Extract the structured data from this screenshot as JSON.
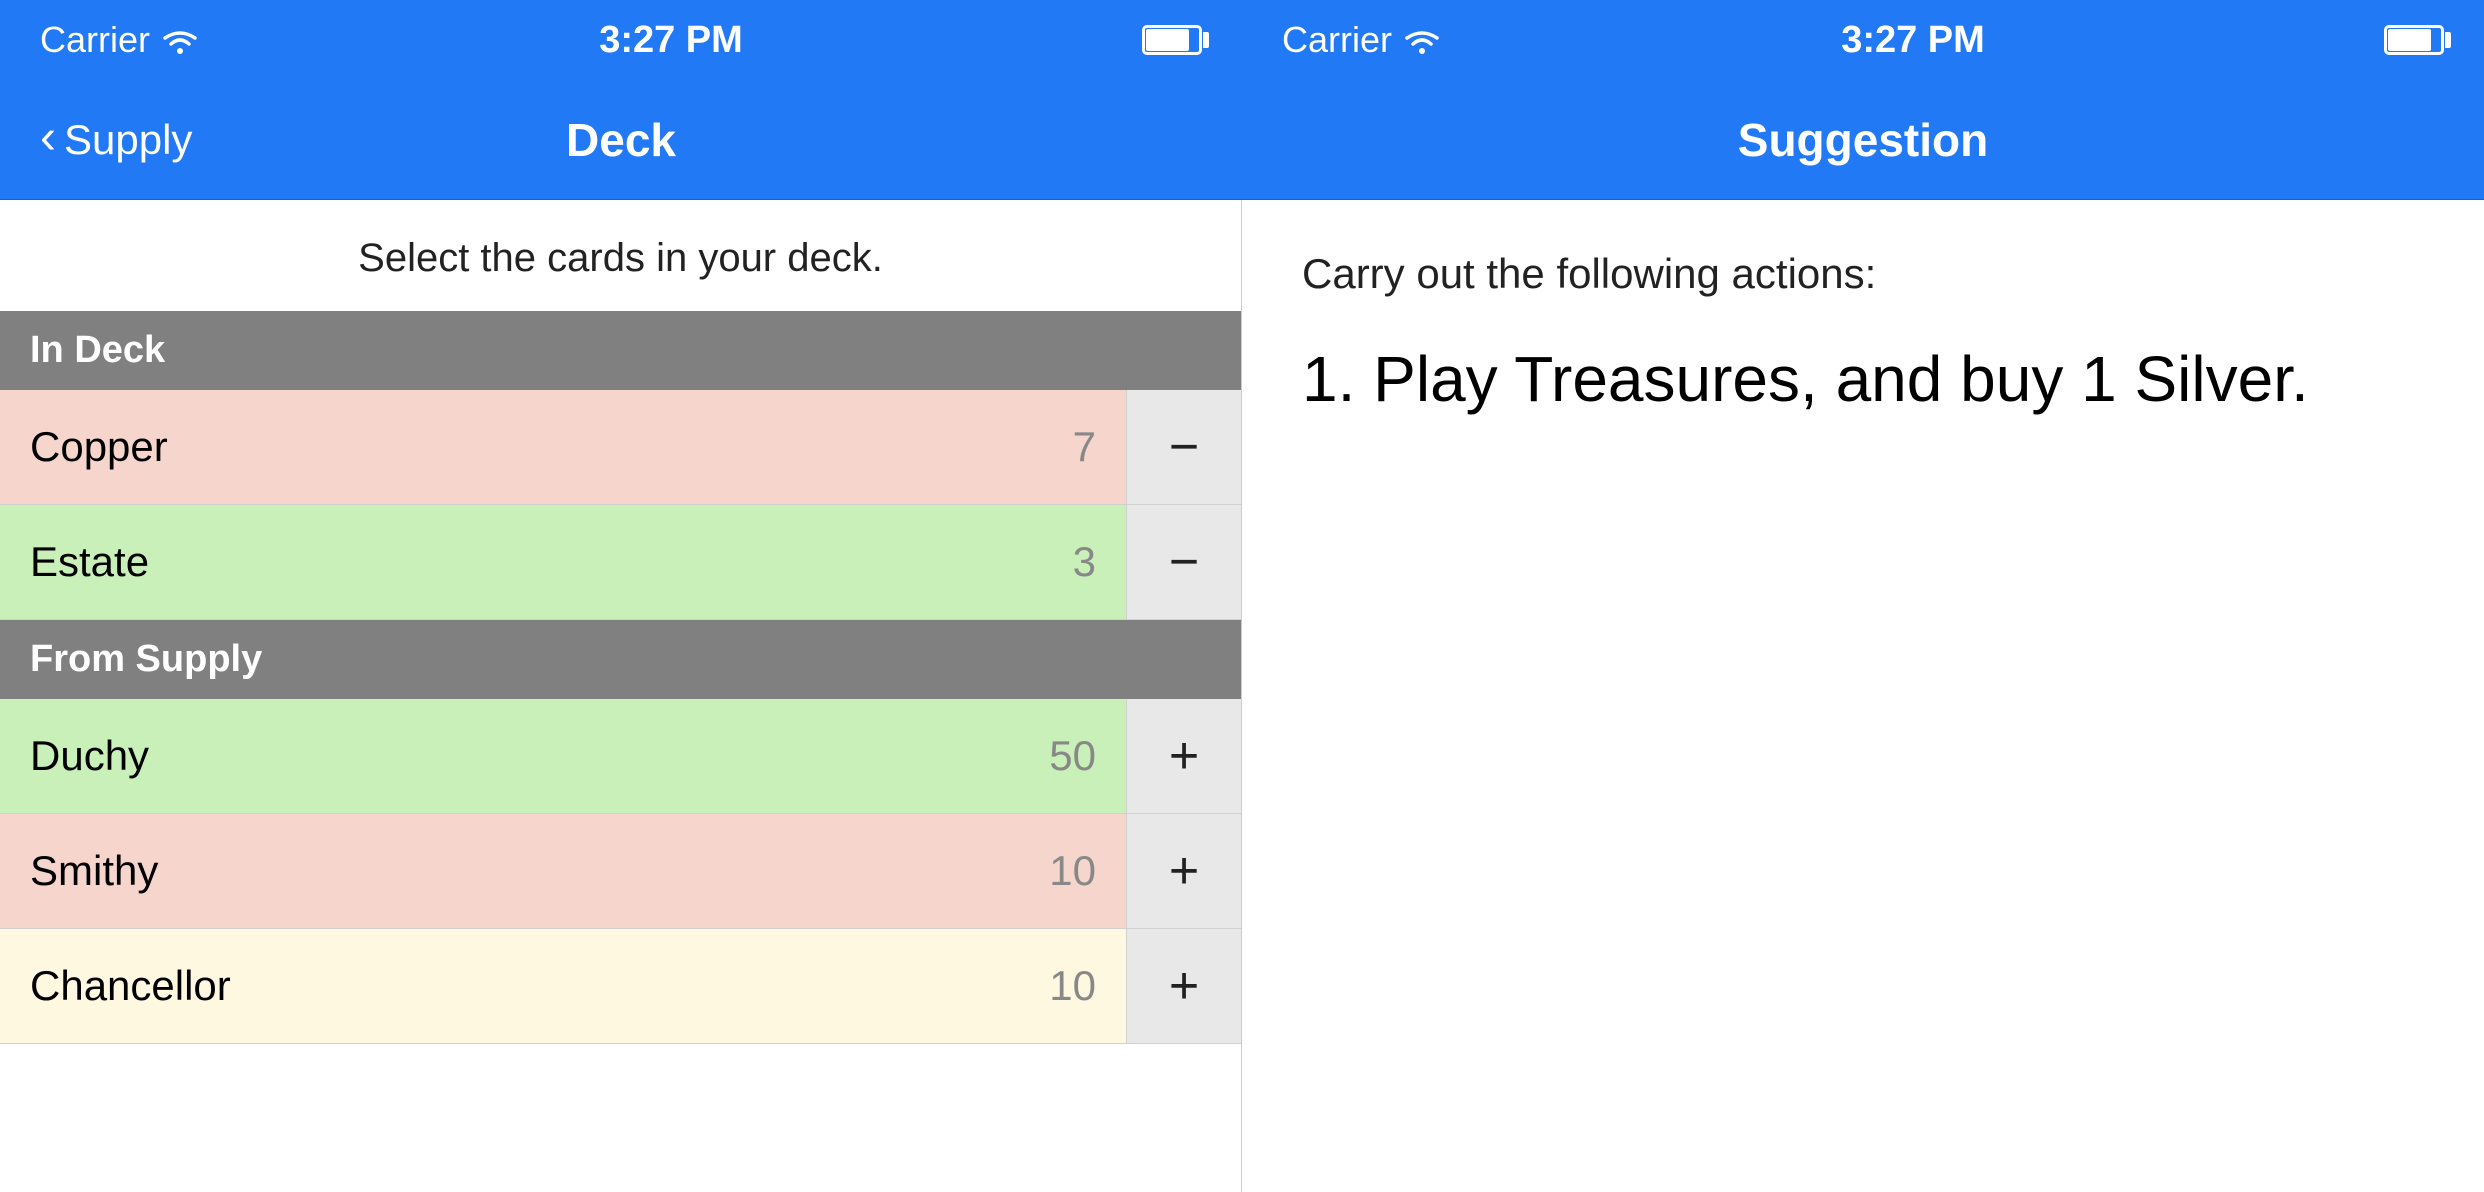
{
  "status_bar": {
    "left": {
      "carrier": "Carrier",
      "time": "3:27 PM"
    },
    "right": {
      "carrier": "Carrier",
      "time": "3:27 PM"
    }
  },
  "nav": {
    "back_label": "Supply",
    "left_title": "Deck",
    "right_title": "Suggestion"
  },
  "deck_panel": {
    "subtitle": "Select the cards in your deck.",
    "sections": [
      {
        "header": "In Deck",
        "cards": [
          {
            "name": "Copper",
            "count": "7",
            "action": "−",
            "color": "copper"
          },
          {
            "name": "Estate",
            "count": "3",
            "action": "−",
            "color": "estate"
          }
        ]
      },
      {
        "header": "From Supply",
        "cards": [
          {
            "name": "Duchy",
            "count": "50",
            "action": "+",
            "color": "duchy"
          },
          {
            "name": "Smithy",
            "count": "10",
            "action": "+",
            "color": "smithy"
          },
          {
            "name": "Chancellor",
            "count": "10",
            "action": "+",
            "color": "chancellor"
          }
        ]
      }
    ]
  },
  "suggestion_panel": {
    "intro": "Carry out the following actions:",
    "action": "1. Play Treasures, and buy 1 Silver."
  }
}
